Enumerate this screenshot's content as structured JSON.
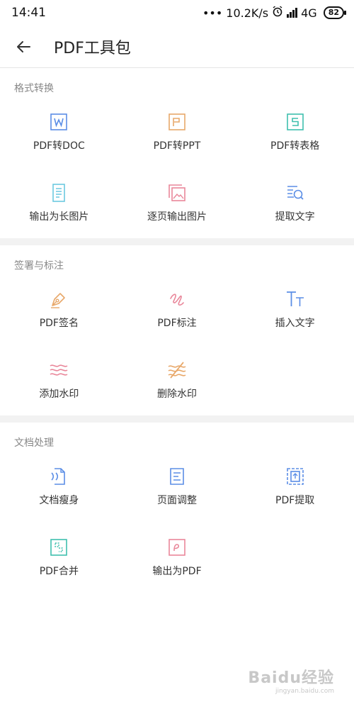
{
  "status_bar": {
    "time": "14:41",
    "speed": "10.2K/s",
    "network": "4G",
    "battery": "82"
  },
  "header": {
    "title": "PDF工具包"
  },
  "colors": {
    "blue": "#5b8ee6",
    "orange": "#e8a86a",
    "teal": "#3fbfae",
    "cyan": "#6cc9e0",
    "pink": "#e9879a",
    "section_gap": "#f2f2f2"
  },
  "sections": [
    {
      "title": "格式转换",
      "items": [
        {
          "label": "PDF转DOC",
          "icon": "word-doc-icon"
        },
        {
          "label": "PDF转PPT",
          "icon": "ppt-icon"
        },
        {
          "label": "PDF转表格",
          "icon": "spreadsheet-icon"
        },
        {
          "label": "输出为长图片",
          "icon": "long-image-icon"
        },
        {
          "label": "逐页输出图片",
          "icon": "page-image-icon"
        },
        {
          "label": "提取文字",
          "icon": "extract-text-icon"
        }
      ]
    },
    {
      "title": "签署与标注",
      "items": [
        {
          "label": "PDF签名",
          "icon": "pen-signature-icon"
        },
        {
          "label": "PDF标注",
          "icon": "annotate-squiggle-icon"
        },
        {
          "label": "插入文字",
          "icon": "insert-text-icon"
        },
        {
          "label": "添加水印",
          "icon": "add-watermark-icon"
        },
        {
          "label": "删除水印",
          "icon": "remove-watermark-icon"
        }
      ]
    },
    {
      "title": "文档处理",
      "items": [
        {
          "label": "文档瘦身",
          "icon": "compress-doc-icon"
        },
        {
          "label": "页面调整",
          "icon": "page-adjust-icon"
        },
        {
          "label": "PDF提取",
          "icon": "pdf-extract-icon"
        },
        {
          "label": "PDF合并",
          "icon": "pdf-merge-icon"
        },
        {
          "label": "输出为PDF",
          "icon": "export-pdf-icon"
        }
      ]
    }
  ],
  "watermark": {
    "text": "Baidu经验",
    "sub": "jingyan.baidu.com"
  }
}
